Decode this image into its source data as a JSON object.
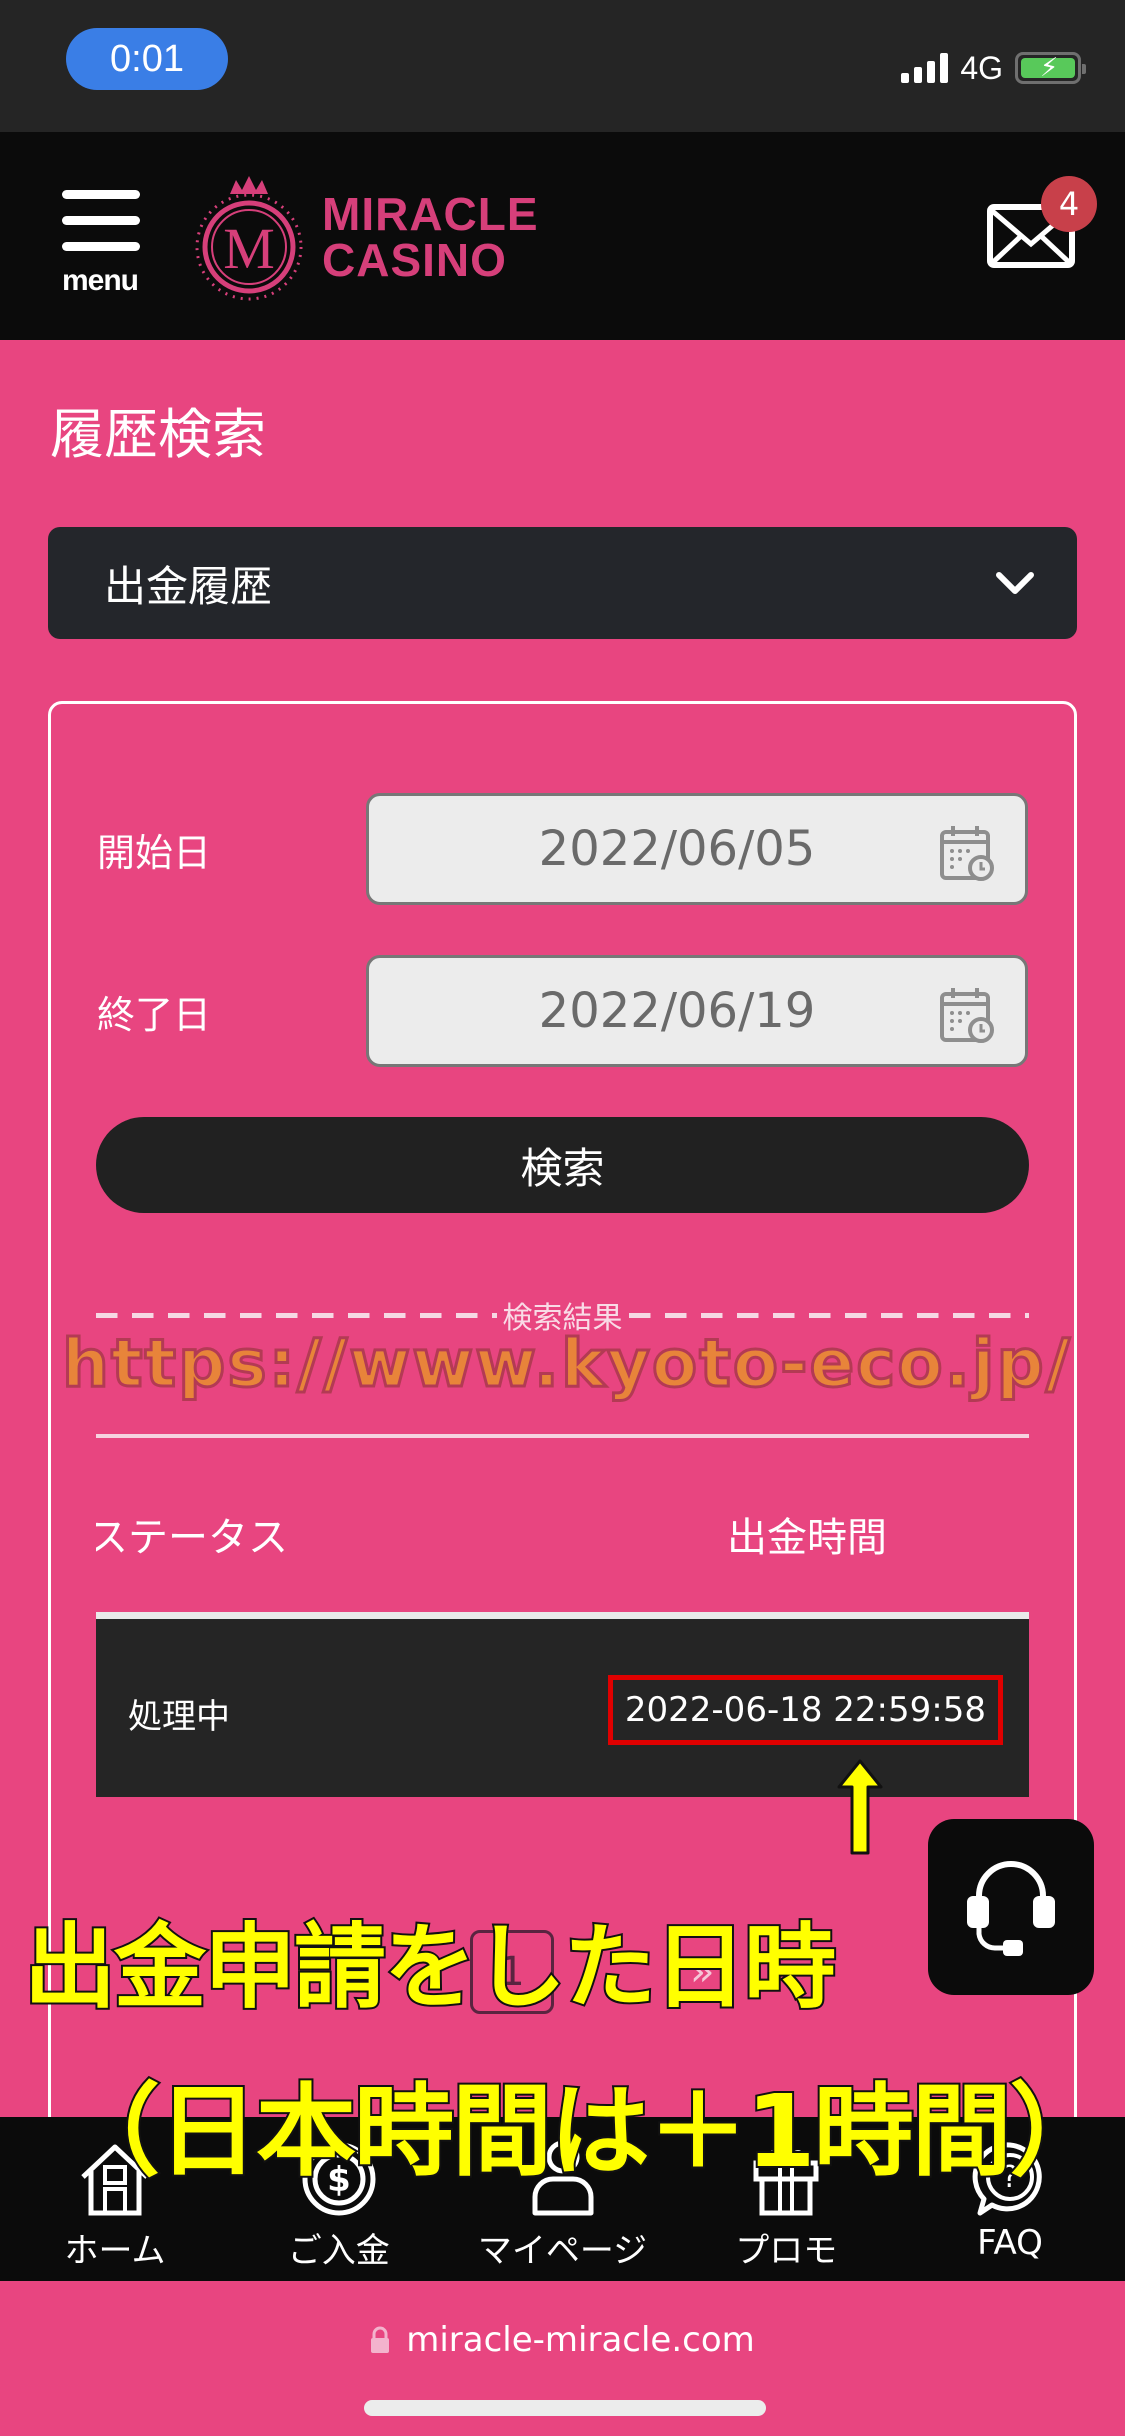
{
  "status_bar": {
    "time": "0:01",
    "network": "4G",
    "battery_charging": true
  },
  "header": {
    "menu_label": "menu",
    "logo_line1": "MIRACLE",
    "logo_line2": "CASINO",
    "logo_monogram": "M",
    "mail_badge_count": "4"
  },
  "page": {
    "title": "履歴検索",
    "history_type_selected": "出金履歴"
  },
  "search_form": {
    "start_label": "開始日",
    "start_value": "2022/06/05",
    "end_label": "終了日",
    "end_value": "2022/06/19",
    "search_button": "検索"
  },
  "results": {
    "divider_label": "検索結果",
    "watermark": "https://www.kyoto-eco.jp/",
    "columns": [
      "ステータス",
      "出金時間"
    ],
    "rows": [
      {
        "status": "処理中",
        "time": "2022-06-18 22:59:58"
      }
    ],
    "pagination": {
      "current_page": "1",
      "next": "›",
      "last": "»"
    }
  },
  "annotations": {
    "line1": "出金申請をした日時",
    "line2": "（日本時間は＋1時間）"
  },
  "bottom_nav": {
    "items": [
      {
        "label": "ホーム",
        "icon": "home-icon"
      },
      {
        "label": "ご入金",
        "icon": "dollar-coin-icon"
      },
      {
        "label": "マイページ",
        "icon": "user-icon"
      },
      {
        "label": "プロモ",
        "icon": "gift-icon"
      },
      {
        "label": "FAQ",
        "icon": "question-bubble-icon"
      }
    ]
  },
  "browser": {
    "url": "miracle-miracle.com"
  },
  "colors": {
    "brand_pink": "#e84580",
    "logo_pink": "#d63f7a",
    "dark": "#0b0b0b",
    "highlight_red": "#e00000",
    "annotation_yellow": "#ffff00"
  }
}
